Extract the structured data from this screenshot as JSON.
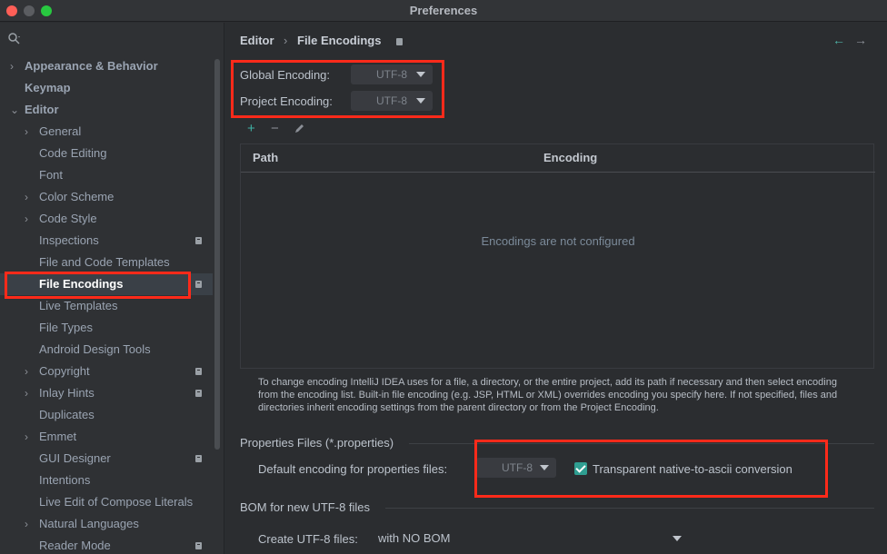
{
  "window": {
    "title": "Preferences"
  },
  "colors": {
    "accent": "#2f9e91",
    "highlight": "#ff2a1a",
    "selection": "#3a4047"
  },
  "sidebar": {
    "search_placeholder": "",
    "items": [
      {
        "label": "Appearance & Behavior",
        "level": 0,
        "bold": true,
        "expandable": true,
        "locked": false,
        "selected": false
      },
      {
        "label": "Keymap",
        "level": 0,
        "bold": true,
        "expandable": false,
        "locked": false,
        "selected": false
      },
      {
        "label": "Editor",
        "level": 0,
        "bold": true,
        "expandable": true,
        "expanded": true,
        "locked": false,
        "selected": false
      },
      {
        "label": "General",
        "level": 1,
        "expandable": true,
        "locked": false,
        "selected": false
      },
      {
        "label": "Code Editing",
        "level": 1,
        "expandable": false,
        "locked": false,
        "selected": false
      },
      {
        "label": "Font",
        "level": 1,
        "expandable": false,
        "locked": false,
        "selected": false
      },
      {
        "label": "Color Scheme",
        "level": 1,
        "expandable": true,
        "locked": false,
        "selected": false
      },
      {
        "label": "Code Style",
        "level": 1,
        "expandable": true,
        "locked": false,
        "selected": false
      },
      {
        "label": "Inspections",
        "level": 1,
        "expandable": false,
        "locked": true,
        "selected": false
      },
      {
        "label": "File and Code Templates",
        "level": 1,
        "expandable": false,
        "locked": false,
        "selected": false
      },
      {
        "label": "File Encodings",
        "level": 1,
        "expandable": false,
        "locked": true,
        "selected": true
      },
      {
        "label": "Live Templates",
        "level": 1,
        "expandable": false,
        "locked": false,
        "selected": false
      },
      {
        "label": "File Types",
        "level": 1,
        "expandable": false,
        "locked": false,
        "selected": false
      },
      {
        "label": "Android Design Tools",
        "level": 1,
        "expandable": false,
        "locked": false,
        "selected": false
      },
      {
        "label": "Copyright",
        "level": 1,
        "expandable": true,
        "locked": true,
        "selected": false
      },
      {
        "label": "Inlay Hints",
        "level": 1,
        "expandable": true,
        "locked": true,
        "selected": false
      },
      {
        "label": "Duplicates",
        "level": 1,
        "expandable": false,
        "locked": false,
        "selected": false
      },
      {
        "label": "Emmet",
        "level": 1,
        "expandable": true,
        "locked": false,
        "selected": false
      },
      {
        "label": "GUI Designer",
        "level": 1,
        "expandable": false,
        "locked": true,
        "selected": false
      },
      {
        "label": "Intentions",
        "level": 1,
        "expandable": false,
        "locked": false,
        "selected": false
      },
      {
        "label": "Live Edit of Compose Literals",
        "level": 1,
        "expandable": false,
        "locked": false,
        "selected": false
      },
      {
        "label": "Natural Languages",
        "level": 1,
        "expandable": true,
        "locked": false,
        "selected": false
      },
      {
        "label": "Reader Mode",
        "level": 1,
        "expandable": false,
        "locked": true,
        "selected": false
      }
    ]
  },
  "breadcrumb": {
    "parent": "Editor",
    "current": "File Encodings"
  },
  "encodings": {
    "global_label": "Global Encoding:",
    "global_value": "UTF-8",
    "project_label": "Project Encoding:",
    "project_value": "UTF-8"
  },
  "table": {
    "columns": [
      "Path",
      "Encoding"
    ],
    "empty_text": "Encodings are not configured"
  },
  "hint_text": "To change encoding IntelliJ IDEA uses for a file, a directory, or the entire project, add its path if necessary and then select encoding from the encoding list. Built-in file encoding (e.g. JSP, HTML or XML) overrides encoding you specify here. If not specified, files and directories inherit encoding settings from the parent directory or from the Project Encoding.",
  "properties": {
    "section_title": "Properties Files (*.properties)",
    "default_label": "Default encoding for properties files:",
    "default_value": "UTF-8",
    "transparent_label": "Transparent native-to-ascii conversion",
    "transparent_checked": true
  },
  "bom": {
    "section_title": "BOM for new UTF-8 files",
    "create_label": "Create UTF-8 files:",
    "create_value": "with NO BOM"
  }
}
